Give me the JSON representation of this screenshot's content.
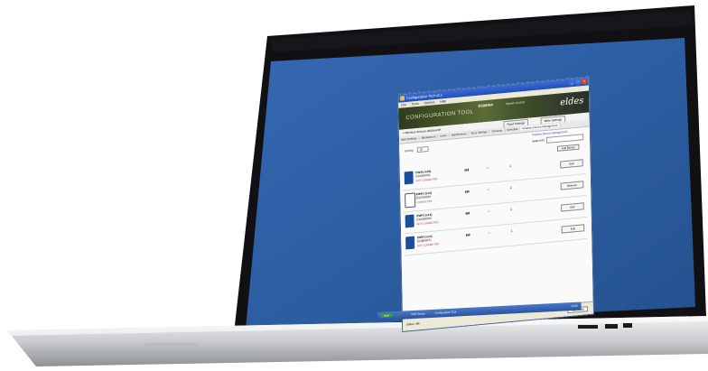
{
  "window": {
    "title": "Configuration Tool v2.x",
    "menu": [
      "File",
      "Tools",
      "Options",
      "Help"
    ]
  },
  "banner": {
    "heading": "CONFIGURATION TOOL",
    "device_name": "ESIM364",
    "version": "Version: 01.00.0",
    "logo": "eldes"
  },
  "toolbar": {
    "connection_label": "< Wireless devices add/search",
    "read_button": "Read Settings",
    "write_button": "Write Settings",
    "wireless_header": "Wireless Device Management"
  },
  "tabs": [
    "Main Settings",
    "Background",
    "Users",
    "Wall Devices",
    "WLS Settings",
    "Cameras",
    "Schedule",
    "Wireless Device Management"
  ],
  "filter": {
    "sort_label": "Sort by:",
    "sort_value": "ID",
    "search_label": "Search ID:",
    "add_button": "Add Device"
  },
  "devices": [
    {
      "name": "EWS1 (v22)",
      "serial": "E10000054",
      "state": "NOT CONNECTED",
      "state_color": "#cc2222",
      "button": "Edit"
    },
    {
      "name": "EWP1 (v14)",
      "serial": "E10700029",
      "state": "CONNECTED",
      "state_color": "#2a8a2a",
      "button": "Remove"
    },
    {
      "name": "EWP1 (v14)",
      "serial": "E10400009",
      "state": "NOT CONNECTED",
      "state_color": "#cc2222",
      "button": "Edit"
    },
    {
      "name": "EWF1 (v14)",
      "serial": "E10800071",
      "state": "NOT CONNECTED",
      "state_color": "#cc2222",
      "button": "Edit"
    }
  ],
  "status": {
    "left": "Status: Idle",
    "right": "Connected"
  },
  "taskbar": {
    "start": "start",
    "items": [
      "USB Device",
      "Configuration Tool"
    ],
    "clock": "12:00"
  },
  "colors": {
    "screen_bg": "#2f60a6",
    "bezel": "#0c0c0f",
    "body_silver": "#d7d9dc",
    "titlebar": "#1f4fb4"
  }
}
